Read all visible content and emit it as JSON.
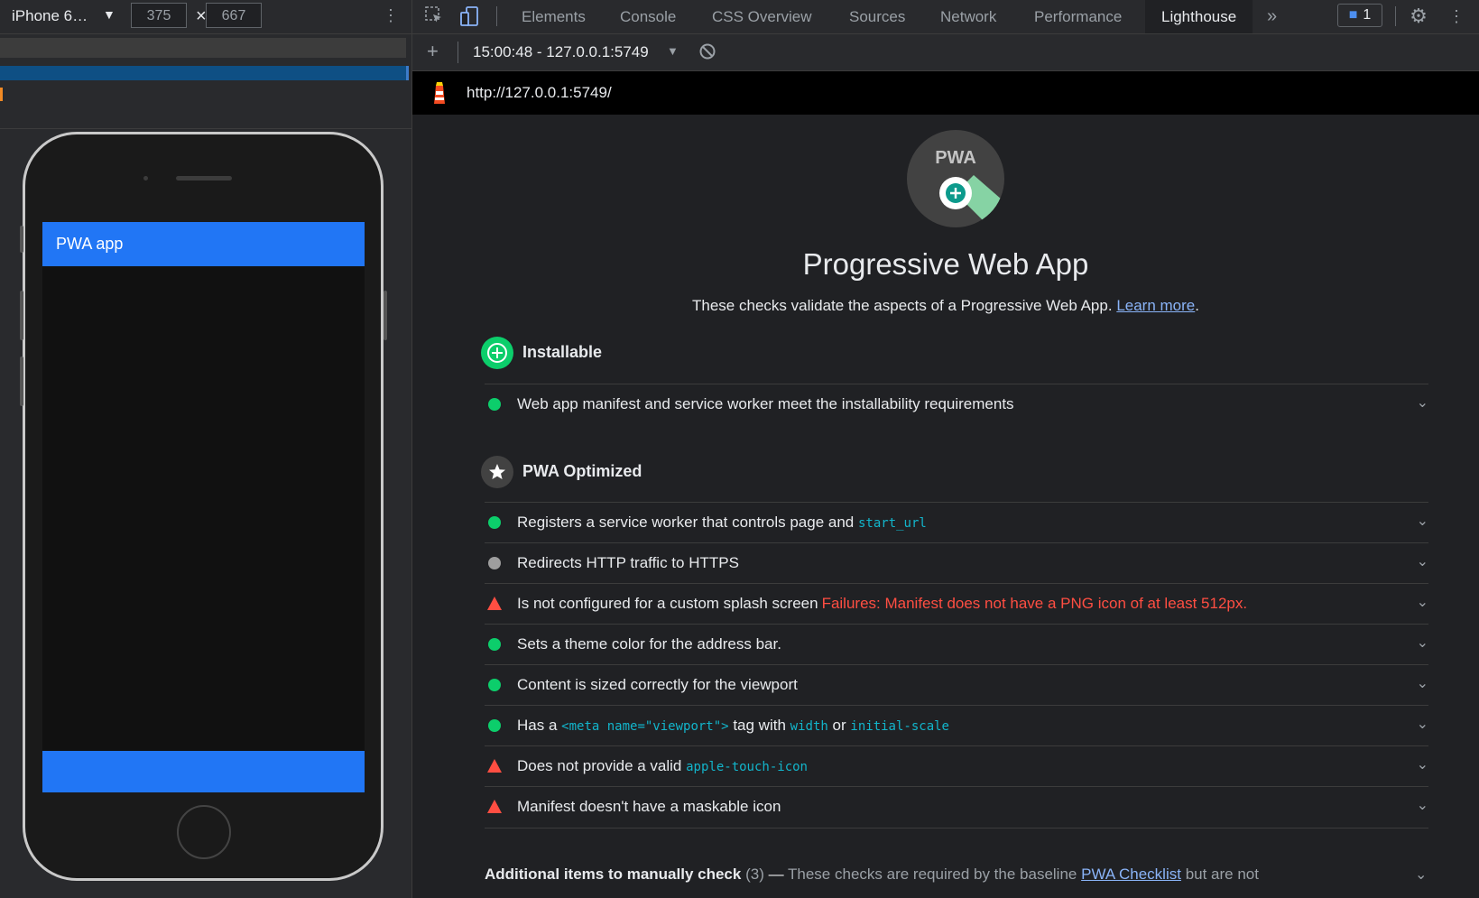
{
  "device_toolbar": {
    "device_name": "iPhone 6…",
    "width": "375",
    "height": "667",
    "times": "×"
  },
  "device_app": {
    "header": "PWA app"
  },
  "devtools": {
    "tabs": [
      "Elements",
      "Console",
      "CSS Overview",
      "Sources",
      "Network",
      "Performance",
      "Lighthouse"
    ],
    "active_tab": "Lighthouse",
    "more_tabs": "»",
    "issues_count": "1",
    "report_select": "15:00:48 - 127.0.0.1:5749",
    "url": "http://127.0.0.1:5749/"
  },
  "category": {
    "gauge_label": "PWA",
    "title": "Progressive Web App",
    "description": "These checks validate the aspects of a Progressive Web App.",
    "learn_more": "Learn more",
    "period": "."
  },
  "groups": {
    "installable": "Installable",
    "pwa_optimized": "PWA Optimized"
  },
  "audits": {
    "installable_1": "Web app manifest and service worker meet the installability requirements",
    "sw_text": "Registers a service worker that controls page and",
    "sw_code": "start_url",
    "https": "Redirects HTTP traffic to HTTPS",
    "splash": "Is not configured for a custom splash screen",
    "splash_fail": "Failures: Manifest does not have a PNG icon of at least 512px.",
    "theme": "Sets a theme color for the address bar.",
    "viewport_sized": "Content is sized correctly for the viewport",
    "meta_a": "Has a",
    "meta_code": "<meta name=\"viewport\">",
    "meta_b": "tag with",
    "meta_code2": "width",
    "meta_c": "or",
    "meta_code3": "initial-scale",
    "apple_text": "Does not provide a valid",
    "apple_code": "apple-touch-icon",
    "maskable": "Manifest doesn't have a maskable icon"
  },
  "manual": {
    "title": "Additional items to manually check",
    "count": "(3)",
    "dash": "—",
    "text_a": "These checks are required by the baseline",
    "checklist": "PWA Checklist",
    "text_b": "but are not"
  },
  "colors": {
    "pass": "#0cce6b",
    "fail": "#ff4e42",
    "na": "#9e9e9e",
    "accent": "#2176f5"
  }
}
